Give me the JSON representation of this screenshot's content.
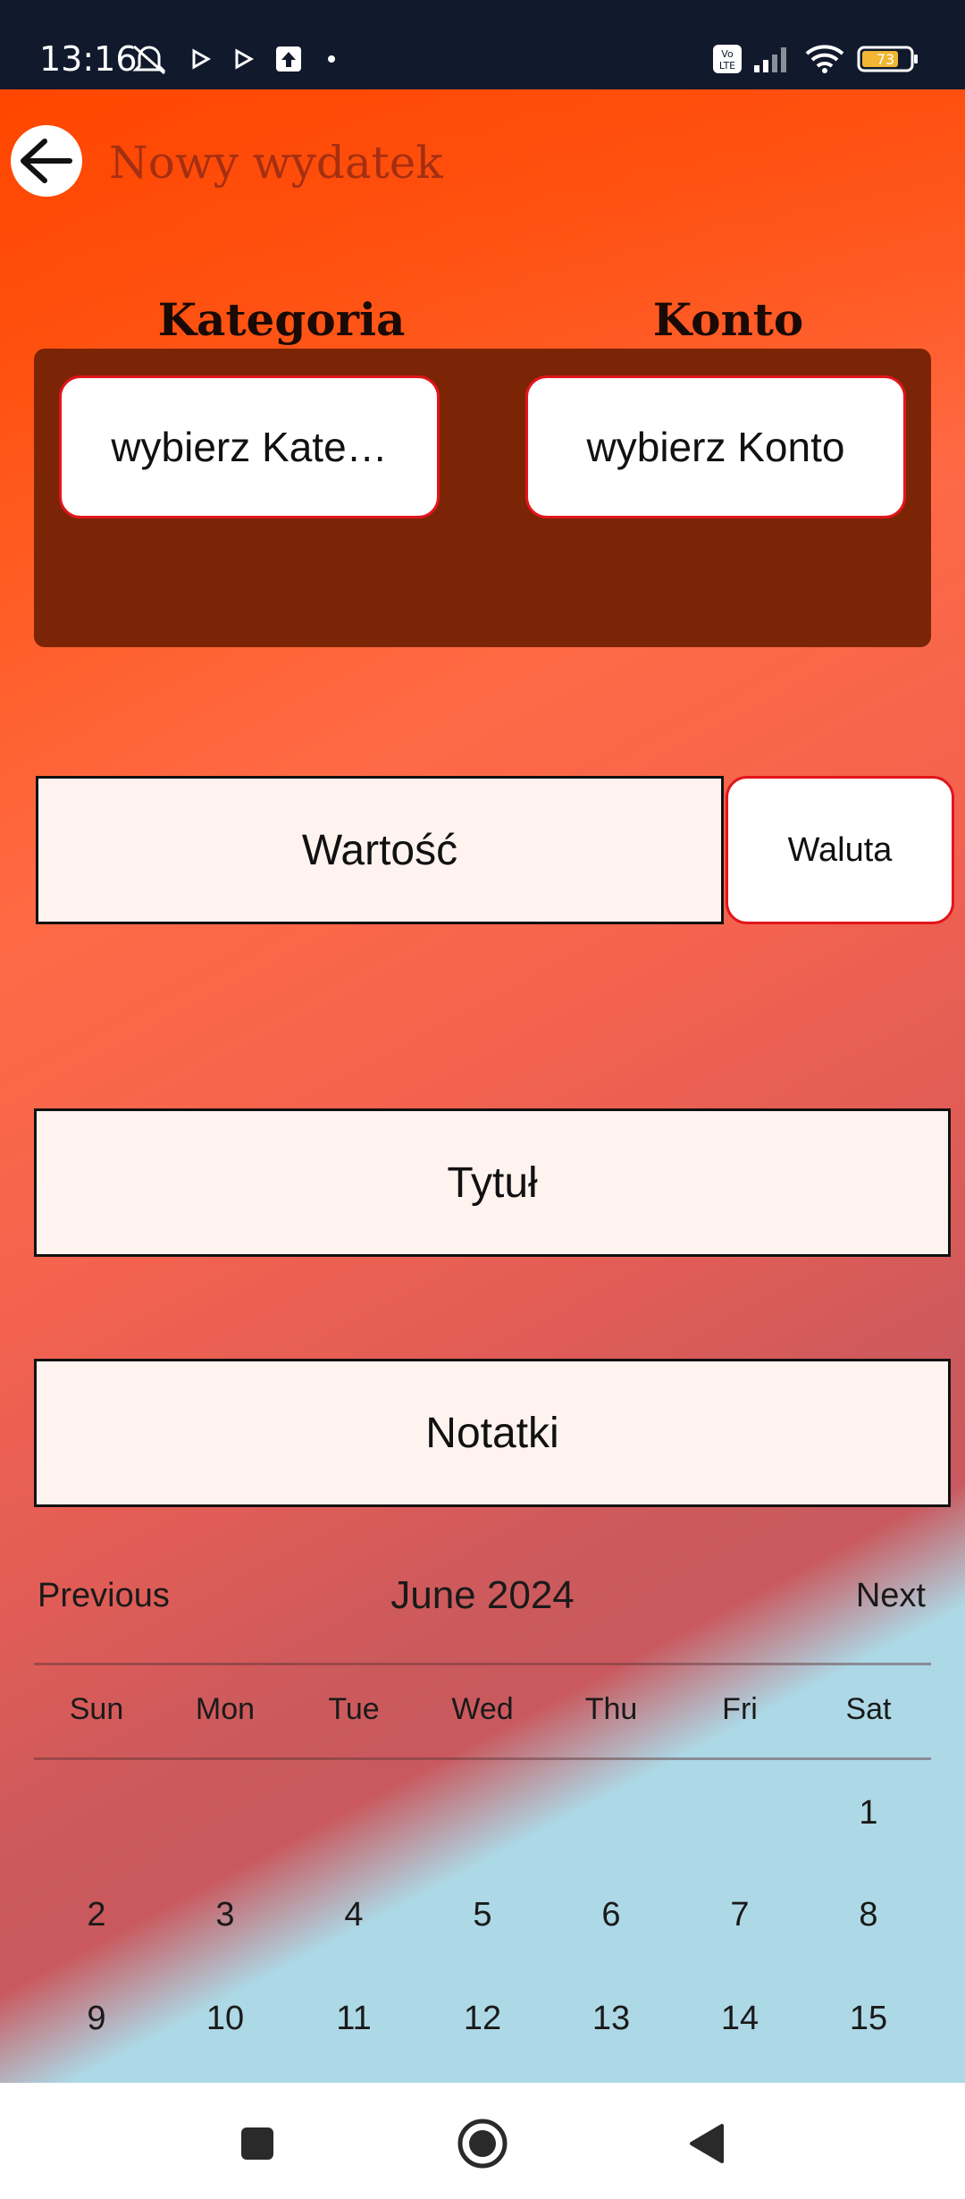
{
  "status_bar": {
    "time": "13:16",
    "battery": "73",
    "network": "LTE"
  },
  "header": {
    "title": "Nowy wydatek"
  },
  "selectors": {
    "category_label": "Kategoria",
    "account_label": "Konto",
    "category_button": "wybierz Kate…",
    "account_button": "wybierz Konto"
  },
  "form": {
    "value_placeholder": "Wartość",
    "currency_button": "Waluta",
    "title_placeholder": "Tytuł",
    "notes_placeholder": "Notatki"
  },
  "calendar": {
    "prev_label": "Previous",
    "month_label": "June 2024",
    "next_label": "Next",
    "weekdays": [
      "Sun",
      "Mon",
      "Tue",
      "Wed",
      "Thu",
      "Fri",
      "Sat"
    ],
    "visible_days": [
      "1",
      "2",
      "3",
      "4",
      "5",
      "6",
      "7",
      "8",
      "9",
      "10",
      "11",
      "12",
      "13",
      "14",
      "15"
    ],
    "first_weekday_index": 6
  },
  "colors": {
    "header_orange": "#ff4700",
    "panel_brown": "#7c2406",
    "button_border_red": "#e2151b",
    "field_bg": "#fff3ef",
    "lower_blue": "#add8e6",
    "status_bar": "#111a2c"
  }
}
